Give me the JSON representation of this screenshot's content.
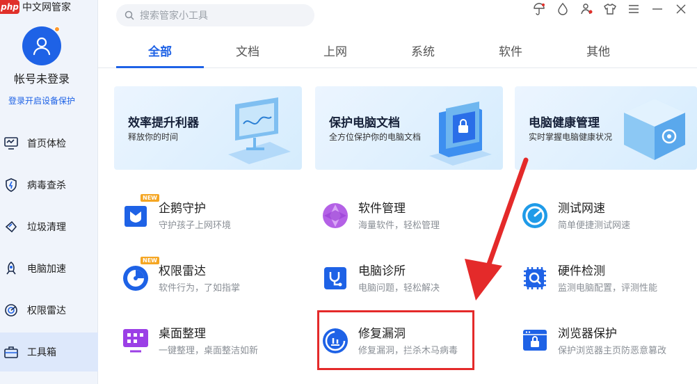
{
  "app": {
    "badge": "php",
    "name": "中文网管家"
  },
  "sidebar": {
    "account": "帐号未登录",
    "login_link": "登录开启设备保护",
    "items": [
      {
        "label": "首页体检",
        "icon": "monitor-check-icon"
      },
      {
        "label": "病毒查杀",
        "icon": "shield-bolt-icon"
      },
      {
        "label": "垃圾清理",
        "icon": "broom-icon"
      },
      {
        "label": "电脑加速",
        "icon": "rocket-icon"
      },
      {
        "label": "权限雷达",
        "icon": "radar-icon"
      },
      {
        "label": "工具箱",
        "icon": "toolbox-icon",
        "active": true
      }
    ]
  },
  "search": {
    "placeholder": "搜索管家小工具"
  },
  "window_icons": [
    "umbrella-icon",
    "drop-icon",
    "person-icon",
    "shirt-icon",
    "menu-icon",
    "minimize-icon",
    "close-icon"
  ],
  "tabs": [
    {
      "label": "全部",
      "active": true
    },
    {
      "label": "文档"
    },
    {
      "label": "上网"
    },
    {
      "label": "系统"
    },
    {
      "label": "软件"
    },
    {
      "label": "其他"
    }
  ],
  "cards": [
    {
      "title": "效率提升利器",
      "subtitle": "释放你的时间"
    },
    {
      "title": "保护电脑文档",
      "subtitle": "全方位保护你的电脑文档"
    },
    {
      "title": "电脑健康管理",
      "subtitle": "实时掌握电脑健康状况"
    }
  ],
  "tools": [
    {
      "name": "企鹅守护",
      "desc": "守护孩子上网环境",
      "icon": "penguin-shield-icon",
      "badge": "NEW"
    },
    {
      "name": "软件管理",
      "desc": "海量软件，轻松管理",
      "icon": "software-manager-icon"
    },
    {
      "name": "测试网速",
      "desc": "简单便捷测试网速",
      "icon": "speedometer-icon"
    },
    {
      "name": "权限雷达",
      "desc": "软件行为，了如指掌",
      "icon": "radar-icon",
      "badge": "NEW"
    },
    {
      "name": "电脑诊所",
      "desc": "电脑问题，轻松解决",
      "icon": "stethoscope-icon"
    },
    {
      "name": "硬件检测",
      "desc": "监测电脑配置，评测性能",
      "icon": "chip-search-icon"
    },
    {
      "name": "桌面整理",
      "desc": "一键整理，桌面整洁如新",
      "icon": "desktop-grid-icon"
    },
    {
      "name": "修复漏洞",
      "desc": "修复漏洞，拦杀木马病毒",
      "icon": "repair-gauge-icon",
      "highlighted": true
    },
    {
      "name": "浏览器保护",
      "desc": "保护浏览器主页防恶意篡改",
      "icon": "browser-lock-icon"
    }
  ],
  "colors": {
    "accent": "#1e62e6",
    "highlight": "#e42a2a",
    "sidebar_bg": "#f0f4fb"
  }
}
